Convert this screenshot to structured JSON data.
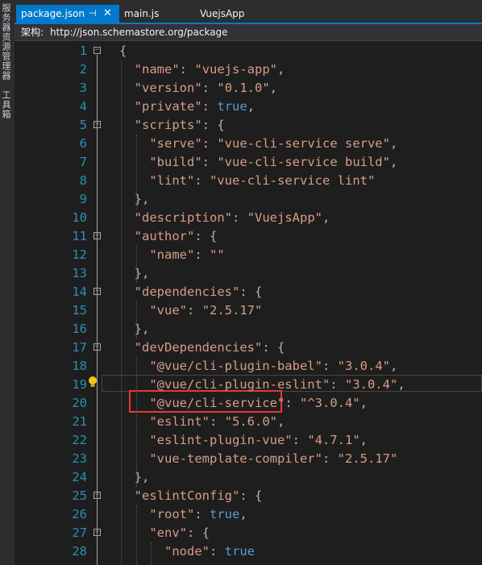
{
  "side_panel": {
    "text1": "服务器资源管理器",
    "text2": "工具箱"
  },
  "tabs": [
    {
      "label": "package.json",
      "active": true
    },
    {
      "label": "main.js",
      "active": false
    },
    {
      "label": "VuejsApp",
      "active": false
    }
  ],
  "schema": {
    "label": "架构:",
    "value": "http://json.schemastore.org/package"
  },
  "code_lines": [
    {
      "n": "1",
      "text": "{"
    },
    {
      "n": "2",
      "text": "  \"name\": \"vuejs-app\","
    },
    {
      "n": "3",
      "text": "  \"version\": \"0.1.0\","
    },
    {
      "n": "4",
      "text": "  \"private\": true,"
    },
    {
      "n": "5",
      "text": "  \"scripts\": {"
    },
    {
      "n": "6",
      "text": "    \"serve\": \"vue-cli-service serve\","
    },
    {
      "n": "7",
      "text": "    \"build\": \"vue-cli-service build\","
    },
    {
      "n": "8",
      "text": "    \"lint\": \"vue-cli-service lint\""
    },
    {
      "n": "9",
      "text": "  },"
    },
    {
      "n": "10",
      "text": "  \"description\": \"VuejsApp\","
    },
    {
      "n": "11",
      "text": "  \"author\": {"
    },
    {
      "n": "12",
      "text": "    \"name\": \"\""
    },
    {
      "n": "13",
      "text": "  },"
    },
    {
      "n": "14",
      "text": "  \"dependencies\": {"
    },
    {
      "n": "15",
      "text": "    \"vue\": \"2.5.17\""
    },
    {
      "n": "16",
      "text": "  },"
    },
    {
      "n": "17",
      "text": "  \"devDependencies\": {"
    },
    {
      "n": "18",
      "text": "    \"@vue/cli-plugin-babel\": \"3.0.4\","
    },
    {
      "n": "19",
      "text": "    \"@vue/cli-plugin-eslint\": \"3.0.4\","
    },
    {
      "n": "20",
      "text": "    \"@vue/cli-service\": \"^3.0.4\","
    },
    {
      "n": "21",
      "text": "    \"eslint\": \"5.6.0\","
    },
    {
      "n": "22",
      "text": "    \"eslint-plugin-vue\": \"4.7.1\","
    },
    {
      "n": "23",
      "text": "    \"vue-template-compiler\": \"2.5.17\""
    },
    {
      "n": "24",
      "text": "  },"
    },
    {
      "n": "25",
      "text": "  \"eslintConfig\": {"
    },
    {
      "n": "26",
      "text": "    \"root\": true,"
    },
    {
      "n": "27",
      "text": "    \"env\": {"
    },
    {
      "n": "28",
      "text": "      \"node\": true"
    }
  ],
  "colors": {
    "accent": "#007acc",
    "line_numbers": "#2b91af",
    "strings": "#d69d85",
    "keyword": "#569cd6",
    "highlight_box": "#e53935"
  }
}
